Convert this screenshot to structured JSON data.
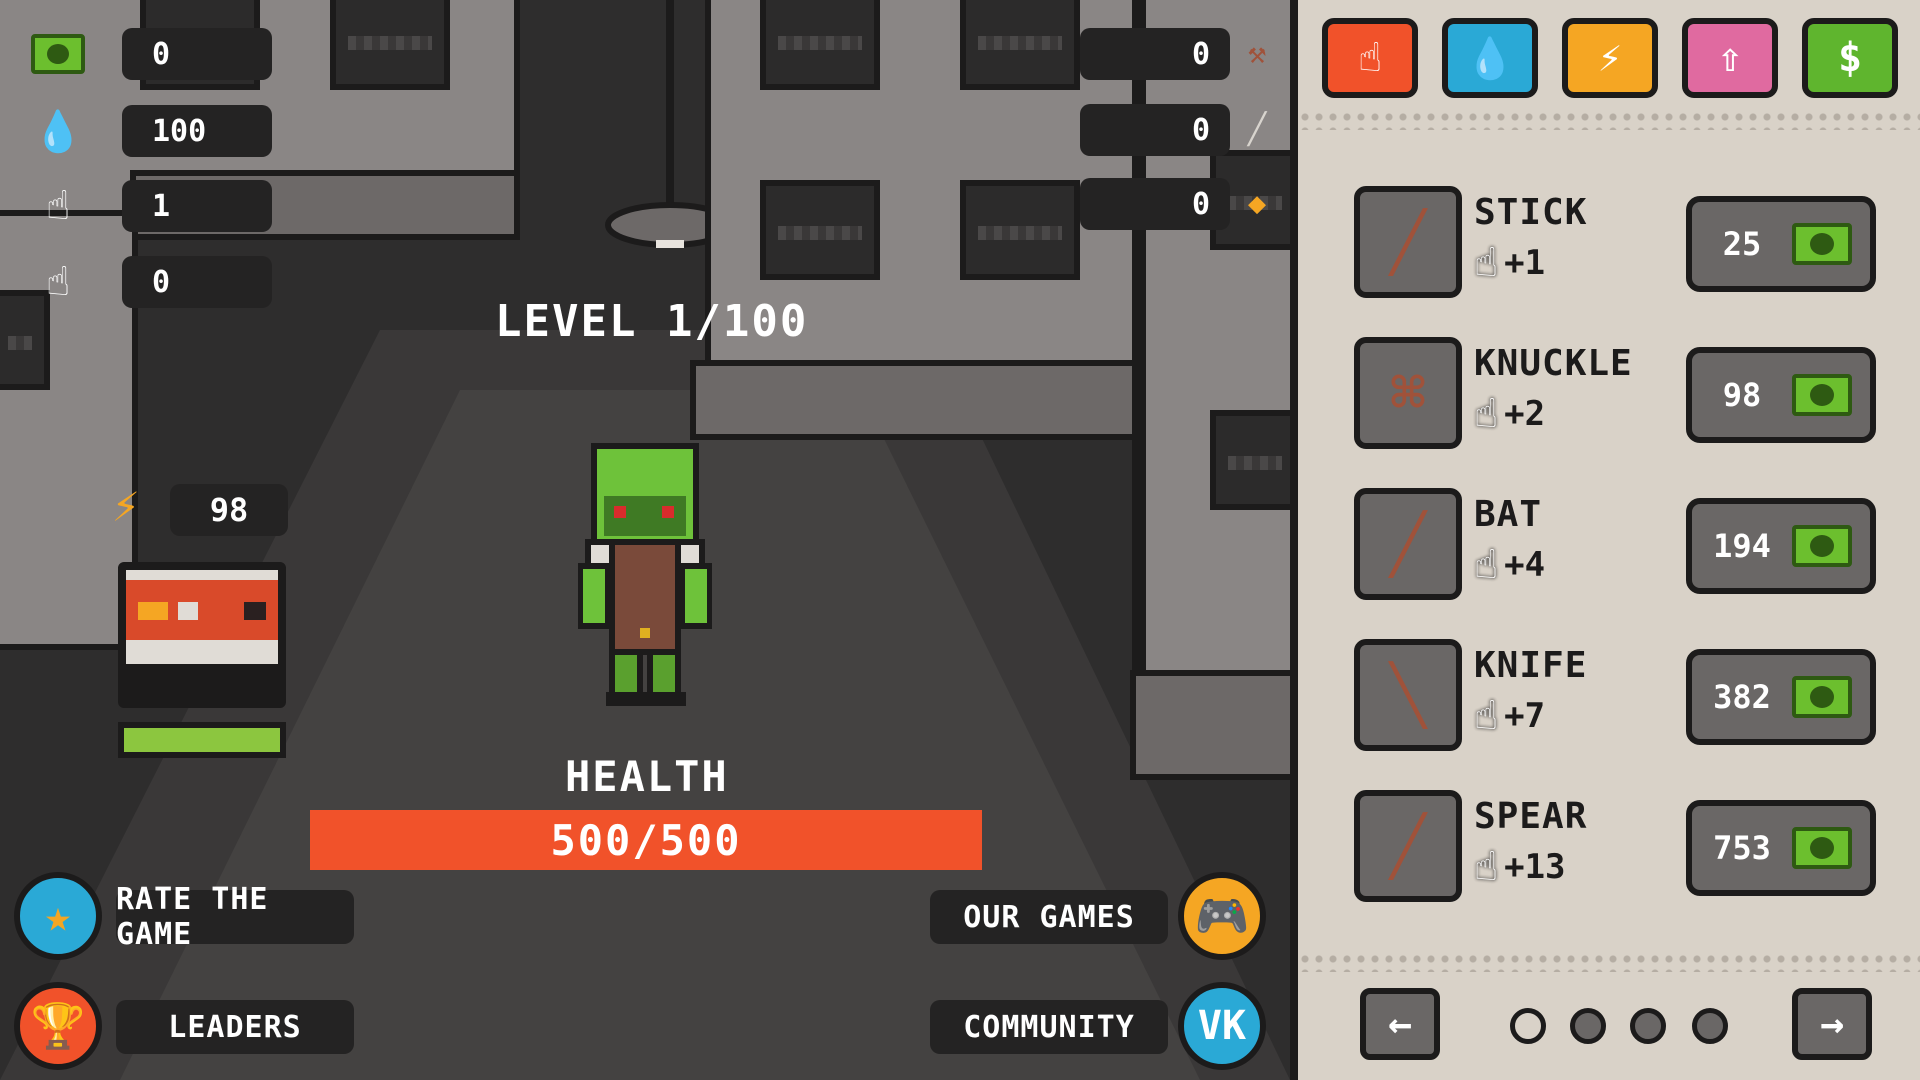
{
  "stats_left": {
    "cash": "0",
    "drops": "100",
    "click_power": "1",
    "auto_click": "0"
  },
  "stats_right": {
    "first": "0",
    "second": "0",
    "third": "0"
  },
  "level": "LEVEL 1/100",
  "energy": "98",
  "generator_fill": 1.0,
  "health": {
    "label": "HEALTH",
    "value": "500/500",
    "fraction": 1.0
  },
  "buttons": {
    "rate": "RATE THE GAME",
    "leaders": "LEADERS",
    "our_games": "OUR GAMES",
    "community": "COMMUNITY",
    "community_icon_text": "VK"
  },
  "shop": {
    "tabs": [
      {
        "icon": "pointer-hand-icon",
        "color": "#f1522a"
      },
      {
        "icon": "water-drop-icon",
        "color": "#2aa9d6"
      },
      {
        "icon": "lightning-icon",
        "color": "#f5a623"
      },
      {
        "icon": "arrow-up-icon",
        "color": "#e06aa0"
      },
      {
        "icon": "dollar-icon",
        "color": "#5fb52e"
      }
    ],
    "items": [
      {
        "name": "STICK",
        "bonus": "+1",
        "bonus_type": "click",
        "price": "25",
        "icon": "stick-icon"
      },
      {
        "name": "KNUCKLE",
        "bonus": "+2",
        "bonus_type": "auto",
        "price": "98",
        "icon": "knuckle-icon"
      },
      {
        "name": "BAT",
        "bonus": "+4",
        "bonus_type": "click",
        "price": "194",
        "icon": "bat-icon"
      },
      {
        "name": "KNIFE",
        "bonus": "+7",
        "bonus_type": "auto",
        "price": "382",
        "icon": "knife-icon"
      },
      {
        "name": "SPEAR",
        "bonus": "+13",
        "bonus_type": "click",
        "price": "753",
        "icon": "spear-icon"
      }
    ],
    "page": 1,
    "pages": 4
  },
  "colors": {
    "health": "#f1522a",
    "cash": "#6cbf2e",
    "panel": "#d9d2c8"
  }
}
